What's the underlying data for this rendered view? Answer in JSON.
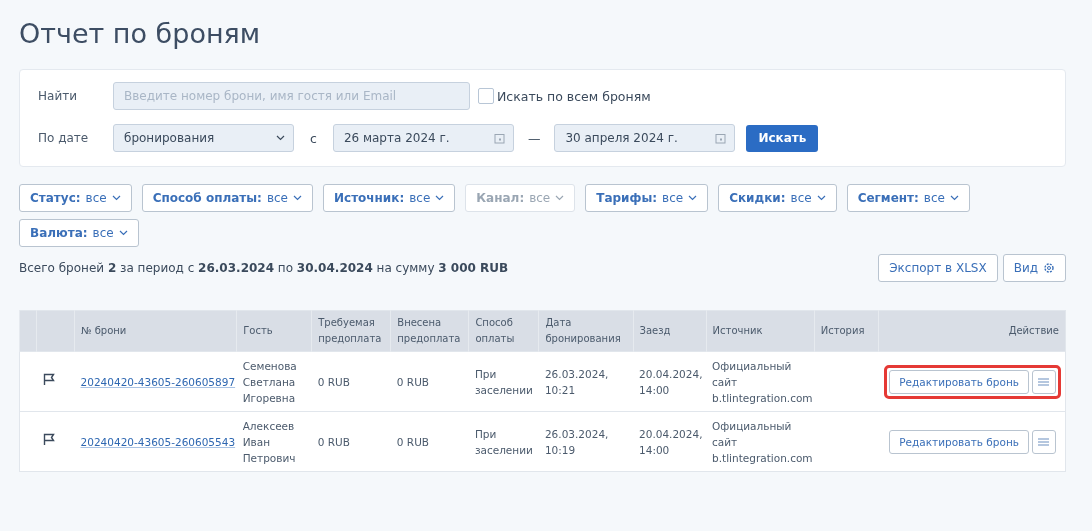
{
  "title": "Отчет по броням",
  "search": {
    "label": "Найти",
    "placeholder": "Введите номер брони, имя гостя или Email",
    "all_label": "Искать по всем броням",
    "all_checked": false
  },
  "date": {
    "label": "По дате",
    "type_value": "бронирования",
    "from_label": "с",
    "from": "26 марта 2024 г.",
    "dash": "—",
    "to": "30 апреля 2024 г.",
    "button": "Искать"
  },
  "filters": [
    {
      "label": "Статус:",
      "value": "все",
      "disabled": false
    },
    {
      "label": "Способ оплаты:",
      "value": "все",
      "disabled": false
    },
    {
      "label": "Источник:",
      "value": "все",
      "disabled": false
    },
    {
      "label": "Канал:",
      "value": "все",
      "disabled": true
    },
    {
      "label": "Тарифы:",
      "value": "все",
      "disabled": false
    },
    {
      "label": "Скидки:",
      "value": "все",
      "disabled": false
    },
    {
      "label": "Сегмент:",
      "value": "все",
      "disabled": false
    },
    {
      "label": "Валюта:",
      "value": "все",
      "disabled": false
    }
  ],
  "summary": "Всего броней **2** за период с **26.03.2024** по **30.04.2024** на сумму **3 000 RUB**",
  "export_button": "Экспорт в XLSX",
  "view_button": "Вид",
  "table": {
    "columns": [
      "№ брони",
      "Гость",
      "Требуемая предоплата",
      "Внесена предоплата",
      "Способ оплаты",
      "Дата бронирования",
      "Заезд",
      "Источник",
      "История",
      "Действие"
    ],
    "rows": [
      {
        "booking": "20240420-43605-260605897",
        "guest": "Семенова Светлана Игоревна",
        "required": "0 RUB",
        "paid": "0 RUB",
        "payment": "При заселении",
        "booked": "26.03.2024, 10:21",
        "checkin": "20.04.2024, 14:00",
        "source": "Официальный сайт b.tlintegration.com",
        "action": "Редактировать бронь",
        "highlighted": true
      },
      {
        "booking": "20240420-43605-260605543",
        "guest": "Алексеев Иван Петрович",
        "required": "0 RUB",
        "paid": "0 RUB",
        "payment": "При заселении",
        "booked": "26.03.2024, 10:19",
        "checkin": "20.04.2024, 14:00",
        "source": "Официальный сайт b.tlintegration.com",
        "action": "Редактировать бронь",
        "highlighted": false
      }
    ]
  }
}
